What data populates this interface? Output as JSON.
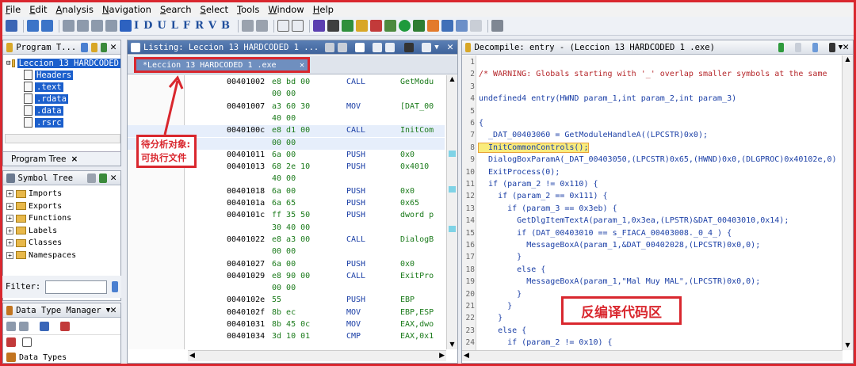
{
  "menu": [
    "File",
    "Edit",
    "Analysis",
    "Navigation",
    "Search",
    "Select",
    "Tools",
    "Window",
    "Help"
  ],
  "toolbar_letters": [
    "I",
    "D",
    "U",
    "L",
    "F",
    "R",
    "V",
    "B"
  ],
  "program_tree": {
    "title": "Program T...",
    "root": "Leccion 13 HARDCODED",
    "items": [
      "Headers",
      ".text",
      ".rdata",
      ".data",
      ".rsrc"
    ],
    "tab": "Program Tree"
  },
  "symbol_tree": {
    "title": "Symbol Tree",
    "items": [
      "Imports",
      "Exports",
      "Functions",
      "Labels",
      "Classes",
      "Namespaces"
    ]
  },
  "filter_label": "Filter:",
  "data_type_manager": {
    "title": "Data Type Manager",
    "footer": "Data Types"
  },
  "listing": {
    "title": "Listing:  Leccion 13 HARDCODED 1 ...",
    "tab": "*Leccion 13 HARDCODED 1 .exe",
    "rows": [
      {
        "addr": "00401002",
        "bytes": "e8 bd 00",
        "mn": "CALL",
        "op": "GetModu"
      },
      {
        "addr": "",
        "bytes": "00 00",
        "mn": "",
        "op": ""
      },
      {
        "addr": "00401007",
        "bytes": "a3 60 30",
        "mn": "MOV",
        "op": "[DAT_00"
      },
      {
        "addr": "",
        "bytes": "40 00",
        "mn": "",
        "op": ""
      },
      {
        "addr": "0040100c",
        "bytes": "e8 d1 00",
        "mn": "CALL",
        "op": "InitCom"
      },
      {
        "addr": "",
        "bytes": "00 00",
        "mn": "",
        "op": ""
      },
      {
        "addr": "00401011",
        "bytes": "6a 00",
        "mn": "PUSH",
        "op": "0x0"
      },
      {
        "addr": "00401013",
        "bytes": "68 2e 10",
        "mn": "PUSH",
        "op": "0x4010"
      },
      {
        "addr": "",
        "bytes": "40 00",
        "mn": "",
        "op": ""
      },
      {
        "addr": "00401018",
        "bytes": "6a 00",
        "mn": "PUSH",
        "op": "0x0"
      },
      {
        "addr": "0040101a",
        "bytes": "6a 65",
        "mn": "PUSH",
        "op": "0x65"
      },
      {
        "addr": "0040101c",
        "bytes": "ff 35 50",
        "mn": "PUSH",
        "op": "dword p"
      },
      {
        "addr": "",
        "bytes": "30 40 00",
        "mn": "",
        "op": ""
      },
      {
        "addr": "00401022",
        "bytes": "e8 a3 00",
        "mn": "CALL",
        "op": "DialogB"
      },
      {
        "addr": "",
        "bytes": "00 00",
        "mn": "",
        "op": ""
      },
      {
        "addr": "00401027",
        "bytes": "6a 00",
        "mn": "PUSH",
        "op": "0x0"
      },
      {
        "addr": "00401029",
        "bytes": "e8 90 00",
        "mn": "CALL",
        "op": "ExitPro"
      },
      {
        "addr": "",
        "bytes": "00 00",
        "mn": "",
        "op": ""
      },
      {
        "addr": "0040102e",
        "bytes": "55",
        "mn": "PUSH",
        "op": "EBP"
      },
      {
        "addr": "0040102f",
        "bytes": "8b ec",
        "mn": "MOV",
        "op": "EBP,ESP"
      },
      {
        "addr": "00401031",
        "bytes": "8b 45 0c",
        "mn": "MOV",
        "op": "EAX,dwo"
      },
      {
        "addr": "00401034",
        "bytes": "3d 10 01",
        "mn": "CMP",
        "op": "EAX,0x1"
      }
    ]
  },
  "annotation_left": "待分析对象:\n可执行文件",
  "decompile": {
    "title": "Decompile: entry -  (Leccion 13 HARDCODED 1 .exe)",
    "lines": [
      "",
      "/* WARNING: Globals starting with '_' overlap smaller symbols at the same",
      "",
      "undefined4 entry(HWND param_1,int param_2,int param_3)",
      "",
      "{",
      "  _DAT_00403060 = GetModuleHandleA((LPCSTR)0x0);",
      "  InitCommonControls();",
      "  DialogBoxParamA(_DAT_00403050,(LPCSTR)0x65,(HWND)0x0,(DLGPROC)0x40102e,0)",
      "  ExitProcess(0);",
      "  if (param_2 != 0x110) {",
      "    if (param_2 == 0x111) {",
      "      if (param_3 == 0x3eb) {",
      "        GetDlgItemTextA(param_1,0x3ea,(LPSTR)&DAT_00403010,0x14);",
      "        if (DAT_00403010 == s_FIACA_00403008._0_4_) {",
      "          MessageBoxA(param_1,&DAT_00402028,(LPCSTR)0x0,0);",
      "        }",
      "        else {",
      "          MessageBoxA(param_1,\"Mal Muy MAL\",(LPCSTR)0x0,0);",
      "        }",
      "      }",
      "    }",
      "    else {",
      "      if (param_2 != 0x10) {"
    ]
  },
  "annotation_right": "反编译代码区"
}
